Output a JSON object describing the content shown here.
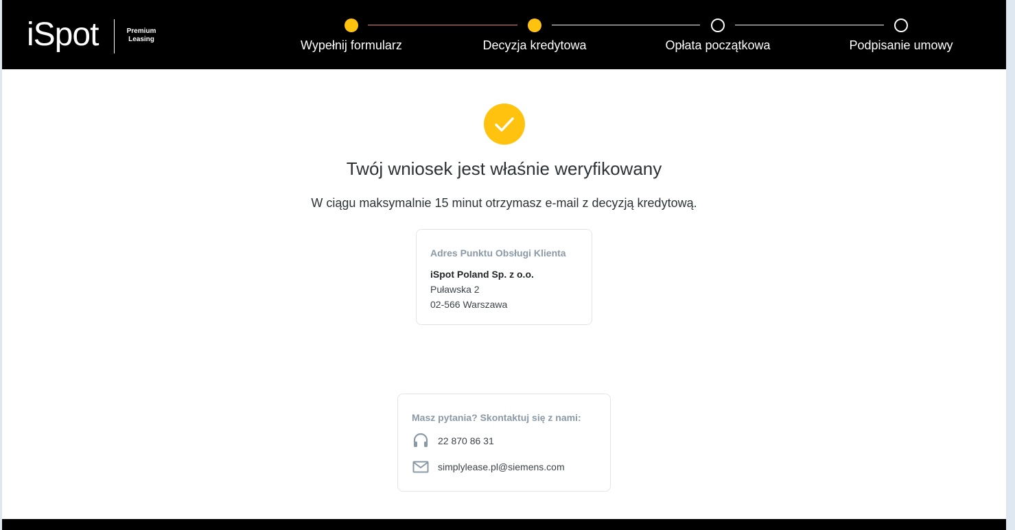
{
  "header": {
    "logo": "iSpot",
    "logo_sub_line1": "Premium",
    "logo_sub_line2": "Leasing"
  },
  "steps": [
    {
      "label": "Wypełnij formularz",
      "state": "done"
    },
    {
      "label": "Decyzja kredytowa",
      "state": "current"
    },
    {
      "label": "Opłata początkowa",
      "state": "todo"
    },
    {
      "label": "Podpisanie umowy",
      "state": "todo"
    }
  ],
  "main": {
    "title": "Twój wniosek jest właśnie weryfikowany",
    "subtitle": "W ciągu maksymalnie 15 minut otrzymasz e-mail z decyzją kredytową."
  },
  "address_card": {
    "heading": "Adres Punktu Obsługi Klienta",
    "company": "iSpot Poland Sp. z o.o.",
    "street": "Puławska 2",
    "city": "02-566 Warszawa"
  },
  "contact_card": {
    "heading": "Masz pytania? Skontaktuj się z nami:",
    "phone": "22 870 86 31",
    "phone_icon": "headset-icon",
    "email": "simplylease.pl@siemens.com",
    "email_icon": "mail-icon"
  },
  "colors": {
    "accent": "#ffc20e",
    "header_bg": "#000000",
    "progress_line_done": "#e8867a",
    "progress_line_todo": "#ffffff",
    "muted_heading": "#8a99a6"
  }
}
